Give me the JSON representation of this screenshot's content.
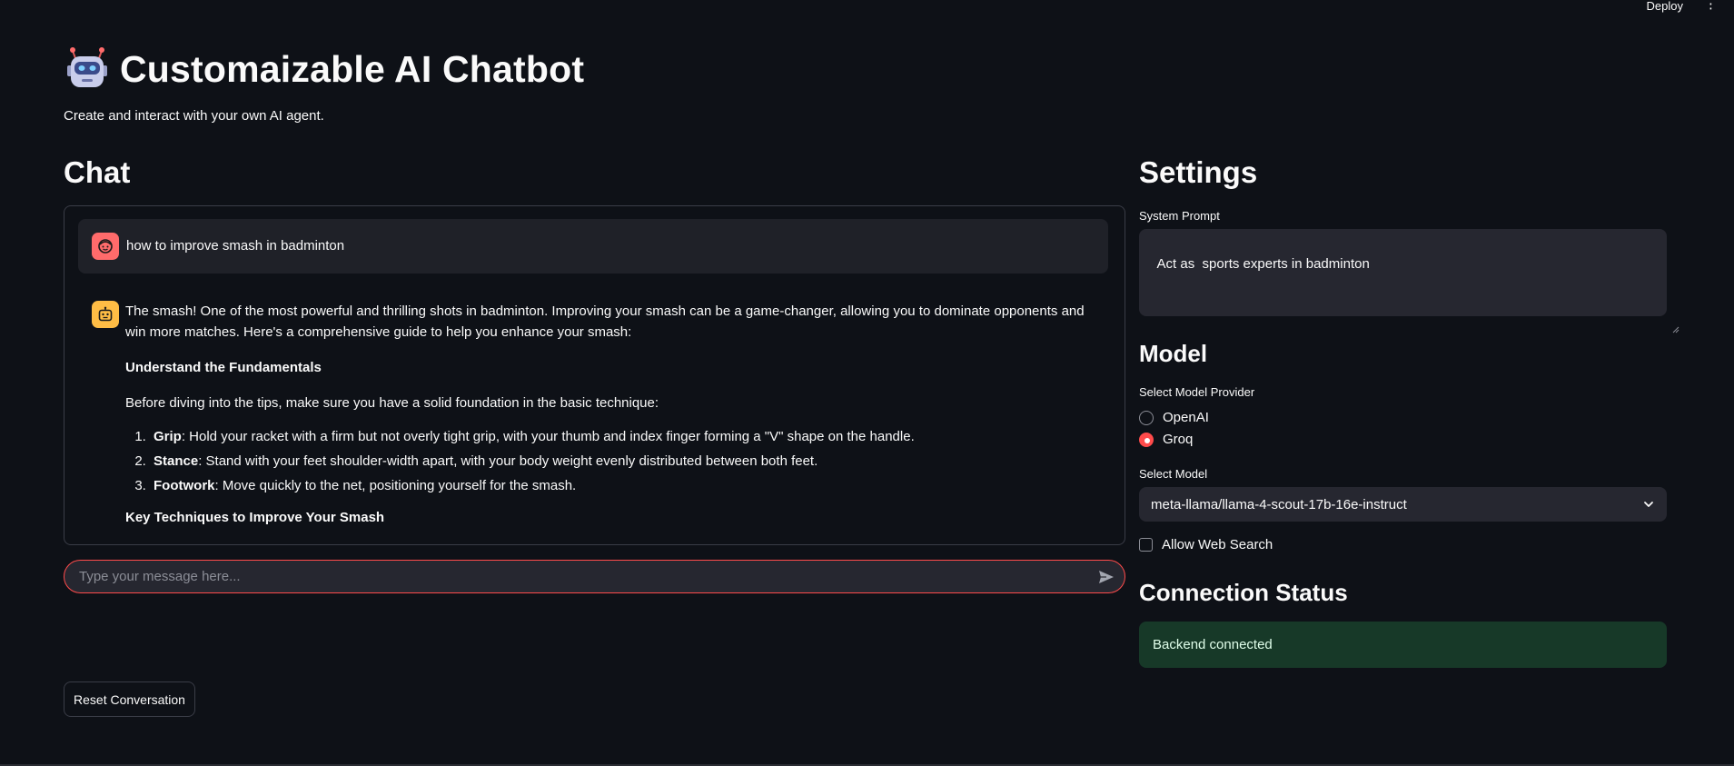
{
  "topbar": {
    "deploy_label": "Deploy",
    "menu_glyph": "⋮"
  },
  "header": {
    "icon": "robot-icon",
    "title": "Customaizable AI Chatbot",
    "subtitle": "Create and interact with your own AI agent."
  },
  "chat": {
    "heading": "Chat",
    "user_message": "how to improve smash in badminton",
    "assistant": {
      "intro": "The smash! One of the most powerful and thrilling shots in badminton. Improving your smash can be a game-changer, allowing you to dominate opponents and win more matches. Here's a comprehensive guide to help you enhance your smash:",
      "section1_title": "Understand the Fundamentals",
      "section1_intro": "Before diving into the tips, make sure you have a solid foundation in the basic technique:",
      "list": [
        {
          "term": "Grip",
          "text": ": Hold your racket with a firm but not overly tight grip, with your thumb and index finger forming a \"V\" shape on the handle."
        },
        {
          "term": "Stance",
          "text": ": Stand with your feet shoulder-width apart, with your body weight evenly distributed between both feet."
        },
        {
          "term": "Footwork",
          "text": ": Move quickly to the net, positioning yourself for the smash."
        }
      ],
      "section2_title": "Key Techniques to Improve Your Smash"
    },
    "input_placeholder": "Type your message here...",
    "reset_label": "Reset Conversation"
  },
  "settings": {
    "heading": "Settings",
    "system_prompt_label": "System Prompt",
    "system_prompt_value": "Act as  sports experts in badminton",
    "model_heading": "Model",
    "provider_label": "Select Model Provider",
    "providers": [
      "OpenAI",
      "Groq"
    ],
    "selected_provider": "Groq",
    "model_label": "Select Model",
    "model_value": "meta-llama/llama-4-scout-17b-16e-instruct",
    "web_search_label": "Allow Web Search",
    "web_search_checked": false,
    "connection_heading": "Connection Status",
    "connection_status": "Backend connected"
  },
  "colors": {
    "background": "#0e1117",
    "accent": "#ff4b4b",
    "user_avatar": "#ff6b6b",
    "bot_avatar": "#ffbd45",
    "success_bg": "#173928"
  }
}
